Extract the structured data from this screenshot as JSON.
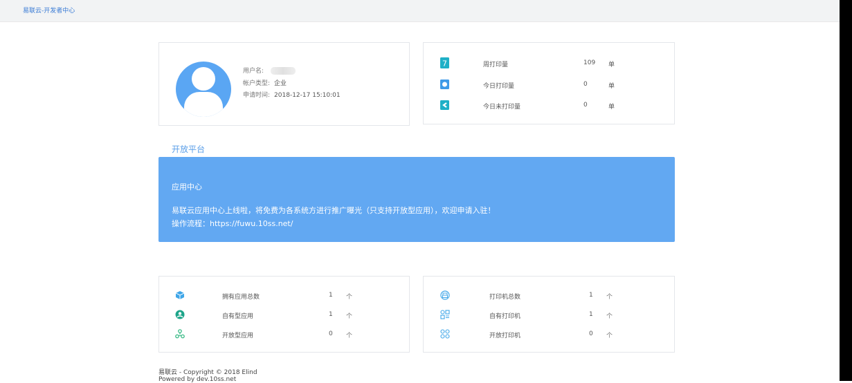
{
  "header": {
    "brand": "易联云-开发者中心"
  },
  "profile": {
    "username_label": "用户名:",
    "username_value": "",
    "account_type_label": "帐户类型:",
    "account_type_value": "企业",
    "apply_time_label": "申请时间:",
    "apply_time_value": "2018-12-17 15:10:01"
  },
  "print_stats": [
    {
      "icon": "calendar-7-icon",
      "name": "周打印量",
      "value": "109",
      "unit": "单"
    },
    {
      "icon": "today-print-icon",
      "name": "今日打印量",
      "value": "0",
      "unit": "单"
    },
    {
      "icon": "unprinted-icon",
      "name": "今日未打印量",
      "value": "0",
      "unit": "单"
    }
  ],
  "section": {
    "title": "开放平台"
  },
  "banner": {
    "title": "应用中心",
    "line1": "易联云应用中心上线啦，将免费为各系统方进行推广曝光（只支持开放型应用），欢迎申请入驻！",
    "line2": "操作流程：https://fuwu.10ss.net/"
  },
  "app_stats": [
    {
      "icon": "cube-icon",
      "name": "拥有应用总数",
      "value": "1",
      "unit": "个"
    },
    {
      "icon": "user-circle-icon",
      "name": "自有型应用",
      "value": "1",
      "unit": "个"
    },
    {
      "icon": "nodes-icon",
      "name": "开放型应用",
      "value": "0",
      "unit": "个"
    }
  ],
  "printer_stats": [
    {
      "icon": "printer-icon",
      "name": "打印机总数",
      "value": "1",
      "unit": "个"
    },
    {
      "icon": "grid-apps-icon",
      "name": "自有打印机",
      "value": "1",
      "unit": "个"
    },
    {
      "icon": "four-circles-icon",
      "name": "开放打印机",
      "value": "0",
      "unit": "个"
    }
  ],
  "footer": {
    "copyright": "易联云 - Copyright © 2018 Elind",
    "powered": "Powered by dev.10ss.net"
  },
  "colors": {
    "accent": "#5aa6f3",
    "banner": "#62a8f2",
    "teal": "#1fb0c7",
    "green": "#2ab57d"
  }
}
